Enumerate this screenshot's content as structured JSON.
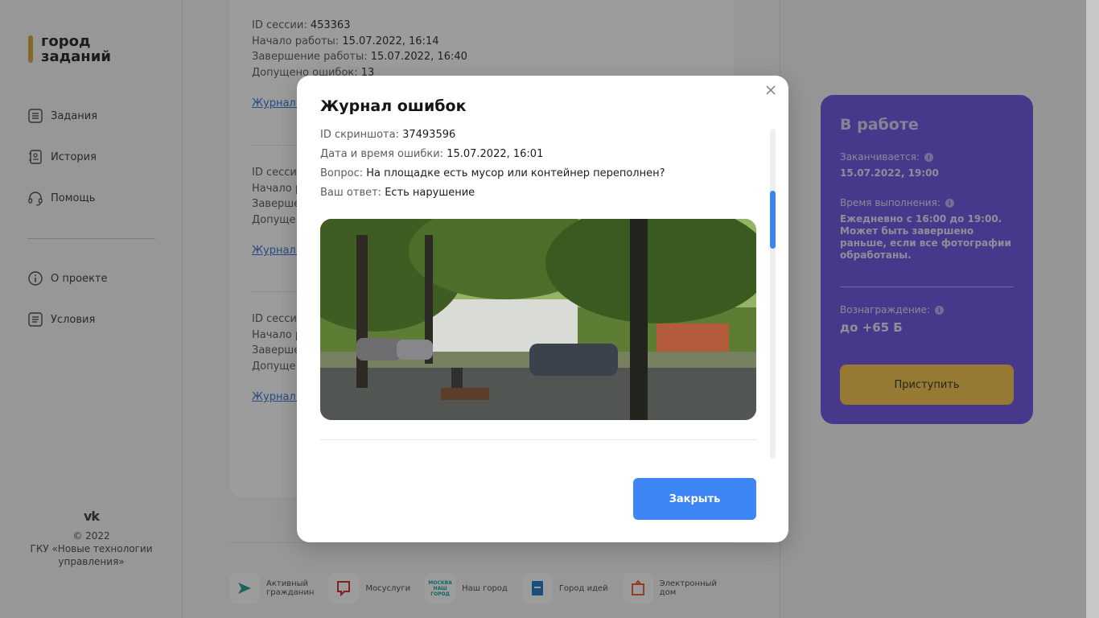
{
  "logo": {
    "line1": "город",
    "line2": "заданий"
  },
  "nav": [
    {
      "label": "Задания",
      "icon": "tasks-icon"
    },
    {
      "label": "История",
      "icon": "history-icon"
    },
    {
      "label": "Помощь",
      "icon": "headset-icon"
    }
  ],
  "nav2": [
    {
      "label": "О проекте",
      "icon": "info-icon"
    },
    {
      "label": "Условия",
      "icon": "terms-icon"
    }
  ],
  "footer": {
    "vk": "vk",
    "copyright": "© 2022",
    "org": "ГКУ «Новые технологии управления»"
  },
  "sessions": {
    "first": {
      "id_label": "ID сессии:",
      "id_value": "453363",
      "start_label": "Начало работы:",
      "start_value": "15.07.2022, 16:14",
      "end_label": "Завершение работы:",
      "end_value": "15.07.2022, 16:40",
      "errors_label": "Допущено ошибок:",
      "errors_value": "13",
      "link": "Журнал ошибок"
    },
    "partial": {
      "id_label": "ID сесси",
      "start_label": "Начало р",
      "end_label": "Заверше",
      "errors_label": "Допуще",
      "link": "Журнал о"
    }
  },
  "partners": [
    {
      "line1": "Активный",
      "line2": "гражданин",
      "color": "#1f9a8e"
    },
    {
      "line1": "Мосуслуги",
      "line2": "",
      "color": "#d2232a"
    },
    {
      "line1": "Наш город",
      "line2": "",
      "color": "#0aa3a0"
    },
    {
      "line1": "Город идей",
      "line2": "",
      "color": "#1a76c4"
    },
    {
      "line1": "Электронный",
      "line2": "дом",
      "color": "#ea5b22"
    }
  ],
  "work": {
    "title": "В работе",
    "ends_label": "Заканчивается:",
    "ends_value": "15.07.2022, 19:00",
    "exec_label": "Время выполнения:",
    "exec_value": "Ежедневно с 16:00 до 19:00. Может быть завершено раньше, если все фотографии обработаны.",
    "reward_label": "Вознаграждение:",
    "reward_value": "до +65 Б",
    "start_button": "Приступить"
  },
  "modal": {
    "title": "Журнал ошибок",
    "screenshot_label": "ID скриншота:",
    "screenshot_value": "37493596",
    "datetime_label": "Дата и время ошибки:",
    "datetime_value": "15.07.2022, 16:01",
    "question_label": "Вопрос:",
    "question_value": "На площадке есть мусор или контейнер переполнен?",
    "answer_label": "Ваш ответ:",
    "answer_value": "Есть нарушение",
    "close_button": "Закрыть"
  },
  "colors": {
    "accent_purple": "#6a4ee0",
    "accent_yellow": "#f4c244",
    "button_blue": "#3e86f5",
    "logo_bar": "#d6a531"
  }
}
